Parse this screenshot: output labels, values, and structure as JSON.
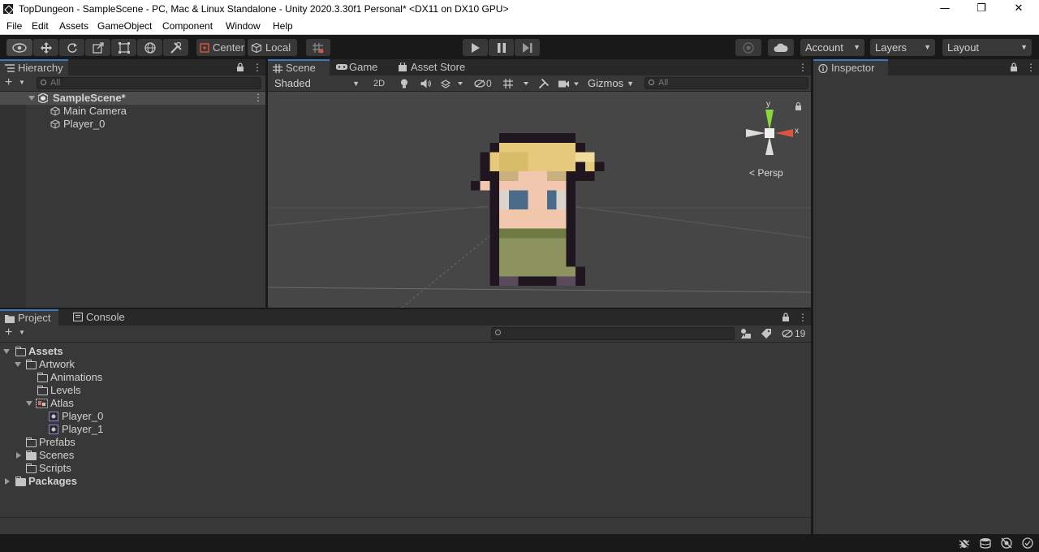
{
  "window": {
    "title": "TopDungeon - SampleScene - PC, Mac & Linux Standalone - Unity 2020.3.30f1 Personal* <DX11 on DX10 GPU>",
    "minimize": "—",
    "maximize": "❐",
    "close": "✕"
  },
  "menu": [
    "File",
    "Edit",
    "Assets",
    "GameObject",
    "Component",
    "Window",
    "Help"
  ],
  "toolbar": {
    "pivot_label": "Center",
    "space_label": "Local",
    "account_label": "Account",
    "layers_label": "Layers",
    "layout_label": "Layout"
  },
  "hierarchy": {
    "tab_label": "Hierarchy",
    "search_placeholder": "All",
    "scene_name": "SampleScene*",
    "objects": [
      "Main Camera",
      "Player_0"
    ]
  },
  "scene": {
    "tabs": [
      "Scene",
      "Game",
      "Asset Store"
    ],
    "shading_mode": "Shaded",
    "mode_2d": "2D",
    "hidden_count": "0",
    "gizmos_label": "Gizmos",
    "search_placeholder": "All",
    "gizmo": {
      "y_label": "y",
      "x_label": "x",
      "projection": "Persp"
    }
  },
  "inspector": {
    "tab_label": "Inspector"
  },
  "project": {
    "tabs": [
      "Project",
      "Console"
    ],
    "hidden_count": "19",
    "tree": {
      "assets": "Assets",
      "artwork": "Artwork",
      "animations": "Animations",
      "levels": "Levels",
      "atlas": "Atlas",
      "player_0": "Player_0",
      "player_1": "Player_1",
      "prefabs": "Prefabs",
      "scenes": "Scenes",
      "scripts": "Scripts",
      "packages": "Packages"
    }
  },
  "colors": {
    "accent": "#3a79bb",
    "panel": "#383838",
    "scene_bg": "#464646"
  }
}
